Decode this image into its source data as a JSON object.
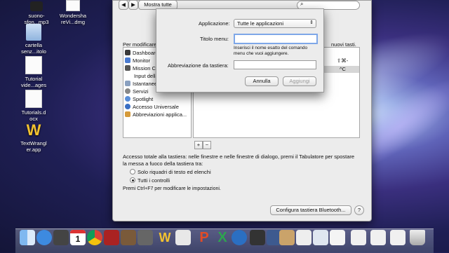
{
  "desktop": {
    "icons": [
      {
        "label": "suono-\nsfon...mp3"
      },
      {
        "label": "Wondersha\nreVi...dmg"
      },
      {
        "label": "cartella\nsenz...itolo"
      },
      {
        "label": "Tutorial\nvide...ages"
      },
      {
        "label": "Tutorials.d\nocx"
      },
      {
        "label": "TextWrangl\ner.app"
      }
    ]
  },
  "window": {
    "show_all_label": "Mostra tutte",
    "intro_left": "Per modificare",
    "intro_right": "nuovi tasti.",
    "categories": [
      {
        "label": "Dashboard e Exposé",
        "icon": "dashboard-icon"
      },
      {
        "label": "Monitor",
        "icon": "monitor-icon"
      },
      {
        "label": "Mission C...",
        "icon": "mission-control-icon"
      },
      {
        "label": "Input della tastiera",
        "icon": "input-icon"
      },
      {
        "label": "Istantanee schermo",
        "icon": "screenshot-icon"
      },
      {
        "label": "Servizi",
        "icon": "gear-icon"
      },
      {
        "label": "Spotlight",
        "icon": "spotlight-icon"
      },
      {
        "label": "Accesso Universale",
        "icon": "accessibility-icon"
      },
      {
        "label": "Abbreviazioni applica...",
        "icon": "app-shortcut-icon"
      }
    ],
    "shortcut_keys": [
      "⇧⌘-",
      "^C"
    ],
    "add_label": "+",
    "remove_label": "−",
    "keyboard_access_text": "Accesso totale alla tastiera: nelle finestre e nelle finestre di dialogo, premi il Tabulatore per spostare la messa a fuoco della tastiera tra:",
    "radio_options": [
      {
        "label": "Solo riquadri di testo ed elenchi",
        "selected": false
      },
      {
        "label": "Tutti i controlli",
        "selected": true
      }
    ],
    "hint_text": "Premi Ctrl+F7 per modificare le impostazioni.",
    "bluetooth_button": "Configura tastiera Bluetooth...",
    "help_label": "?"
  },
  "sheet": {
    "app_label": "Applicazione:",
    "app_value": "Tutte le applicazioni",
    "menu_title_label": "Titolo menu:",
    "menu_title_value": "",
    "menu_hint": "Inserisci il nome esatto del comando\nmenu che vuoi aggiungere.",
    "shortcut_label": "Abbreviazione da tastiera:",
    "shortcut_value": "",
    "cancel_label": "Annulla",
    "add_label": "Aggiungi"
  },
  "dock": {
    "calendar_day": "1",
    "icons": [
      "finder-icon",
      "appstore-icon",
      "facetime-icon",
      "calendar-icon",
      "chrome-icon",
      "photobooth-icon",
      "photo-icon",
      "preview-icon",
      "textwrangler-icon",
      "libreoffice-icon",
      "powerpoint-icon",
      "excel-icon",
      "quicktime-icon",
      "screenflow-icon",
      "keynote-icon",
      "archive-icon",
      "document-icon",
      "finder-window-icon",
      "window-thumb-icon",
      "window-thumb-icon",
      "window-thumb-icon",
      "trash-icon"
    ]
  }
}
